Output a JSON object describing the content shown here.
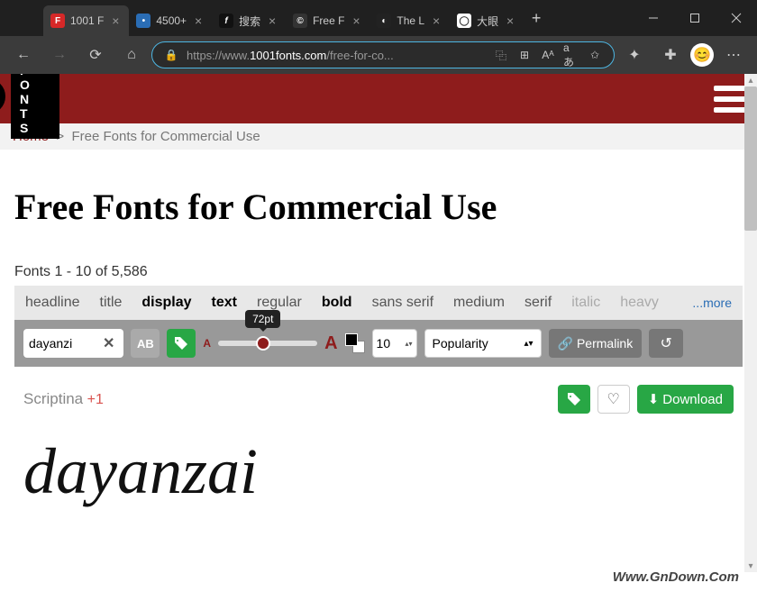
{
  "browser": {
    "tabs": [
      {
        "label": "1001 F",
        "icon_bg": "#d62828",
        "icon_char": "F",
        "active": true
      },
      {
        "label": "4500+",
        "icon_bg": "#2a6db5",
        "icon_char": "•",
        "active": false
      },
      {
        "label": "搜索",
        "icon_bg": "#111",
        "icon_char": "f",
        "active": false
      },
      {
        "label": "Free F",
        "icon_bg": "#333",
        "icon_char": "©",
        "active": false
      },
      {
        "label": "The L",
        "icon_bg": "#222",
        "icon_char": "◐",
        "active": false
      },
      {
        "label": "大眼",
        "icon_bg": "#fff",
        "icon_char": "◯",
        "active": false
      }
    ],
    "url_prefix": "https://www.",
    "url_domain": "1001fonts.com",
    "url_path": "/free-for-co..."
  },
  "site": {
    "logo": "F O N T S",
    "breadcrumb_home": "Home",
    "breadcrumb_sep": ">",
    "breadcrumb_current": "Free Fonts for Commercial Use"
  },
  "page_title": "Free Fonts for Commercial Use",
  "results": "Fonts 1 - 10 of 5,586",
  "tags": [
    "headline",
    "title",
    "display",
    "text",
    "regular",
    "bold",
    "sans serif",
    "medium",
    "serif",
    "italic",
    "heavy"
  ],
  "tag_more": "...more",
  "active_tags": [
    "display",
    "text",
    "bold"
  ],
  "preview_text": "dayanzi",
  "slider_tip": "72pt",
  "font_size_value": "10",
  "sort_by": "Popularity",
  "permalink_label": "Permalink",
  "font_list": [
    {
      "name": "Scriptina",
      "plus": "+1",
      "download_label": "Download",
      "preview": "dayanzai"
    }
  ],
  "watermark": "Www.GnDown.Com"
}
